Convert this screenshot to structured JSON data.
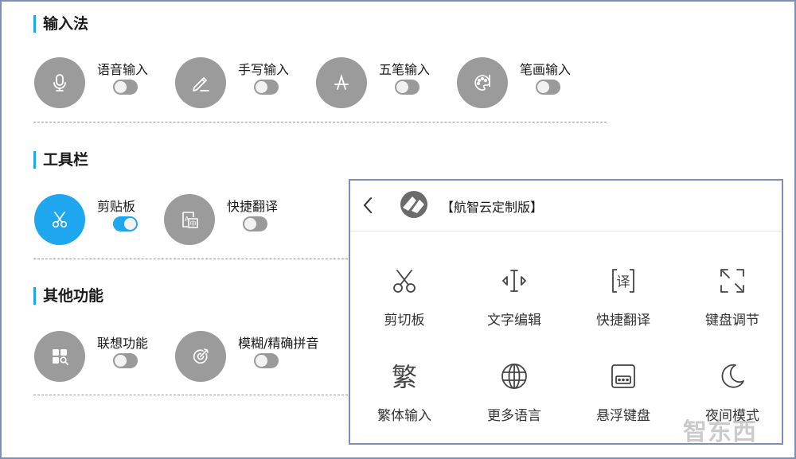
{
  "sections": {
    "input_method": {
      "title": "输入法",
      "items": [
        {
          "label": "语音输入",
          "icon": "microphone-icon",
          "toggle_on": false
        },
        {
          "label": "手写输入",
          "icon": "pen-icon",
          "toggle_on": false
        },
        {
          "label": "五笔输入",
          "icon": "wubi-icon",
          "toggle_on": false
        },
        {
          "label": "笔画输入",
          "icon": "palette-icon",
          "toggle_on": false
        }
      ]
    },
    "toolbar": {
      "title": "工具栏",
      "items": [
        {
          "label": "剪贴板",
          "icon": "scissors-icon",
          "toggle_on": true
        },
        {
          "label": "快捷翻译",
          "icon": "translate-icon",
          "toggle_on": false
        }
      ]
    },
    "other": {
      "title": "其他功能",
      "items": [
        {
          "label": "联想功能",
          "icon": "grid-search-icon",
          "toggle_on": false
        },
        {
          "label": "模糊/精确拼音",
          "icon": "target-icon",
          "toggle_on": false
        }
      ]
    }
  },
  "panel": {
    "title": "【航智云定制版】",
    "tools": [
      {
        "label": "剪切板",
        "icon": "scissors-icon"
      },
      {
        "label": "文字编辑",
        "icon": "text-cursor-icon"
      },
      {
        "label": "快捷翻译",
        "icon": "translate-icon"
      },
      {
        "label": "键盘调节",
        "icon": "resize-icon"
      },
      {
        "label": "繁体输入",
        "icon": "traditional-char-icon"
      },
      {
        "label": "更多语言",
        "icon": "globe-icon"
      },
      {
        "label": "悬浮键盘",
        "icon": "floating-keyboard-icon"
      },
      {
        "label": "夜间模式",
        "icon": "moon-icon"
      }
    ]
  },
  "icon_glyphs": {
    "traditional_char": "繁",
    "wubi_char": "A",
    "translate_char": "译"
  },
  "watermark": "智东西",
  "colors": {
    "accent": "#1ea7ee",
    "icon_circle": "#9b9b9b",
    "frame_border": "#7d8fb8"
  }
}
